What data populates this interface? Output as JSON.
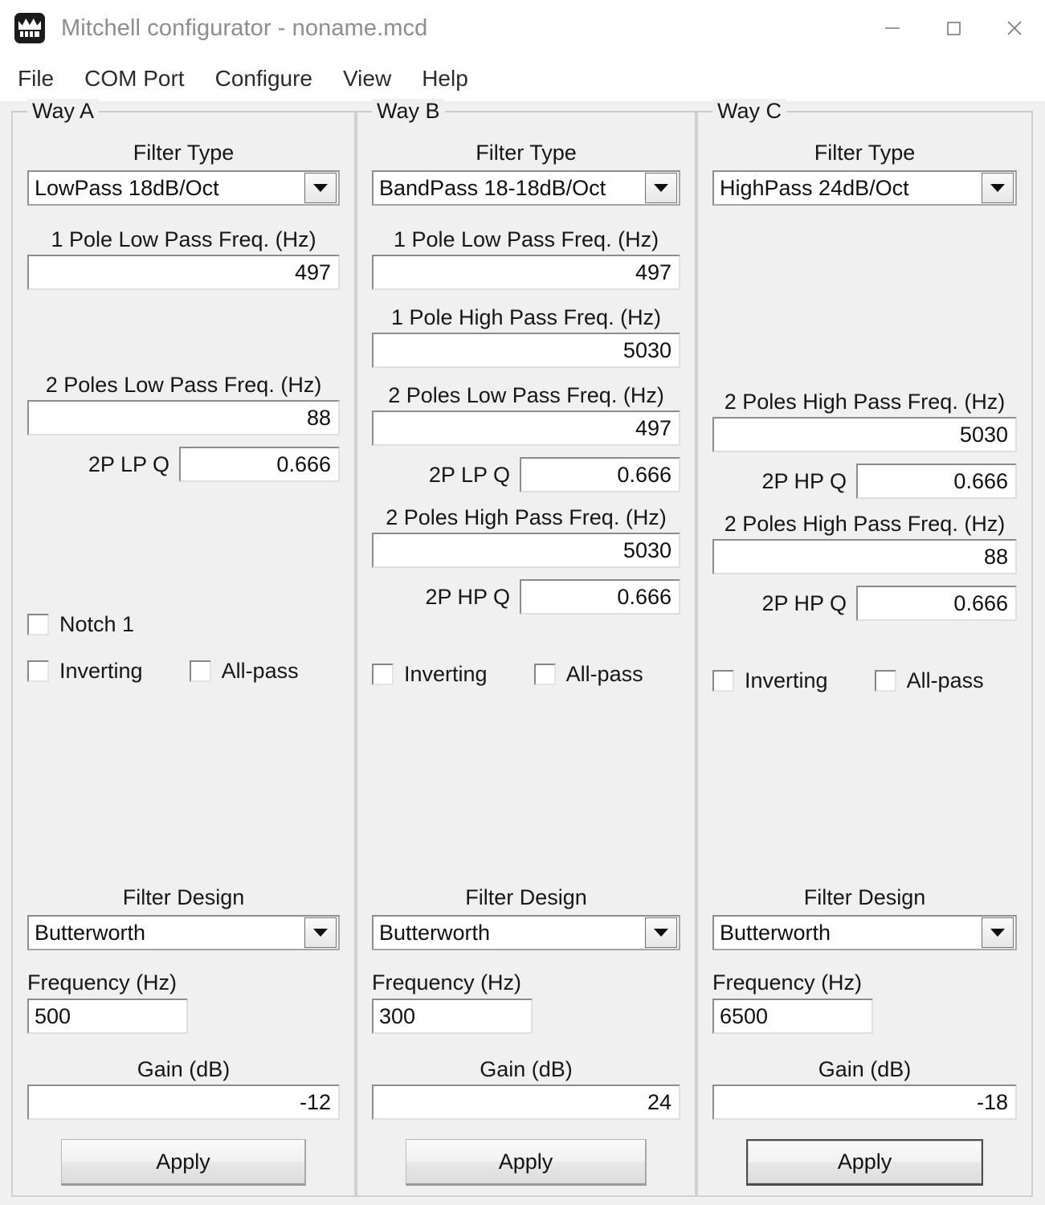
{
  "window": {
    "title": "Mitchell configurator - noname.mcd",
    "icon": "app-icon",
    "minimize": "minimize-icon",
    "maximize": "maximize-icon",
    "close": "close-icon"
  },
  "menu": {
    "items": [
      {
        "label": "File"
      },
      {
        "label": "COM Port"
      },
      {
        "label": "Configure"
      },
      {
        "label": "View"
      },
      {
        "label": "Help"
      }
    ]
  },
  "labels": {
    "filter_type": "Filter Type",
    "one_pole_low_pass": "1 Pole Low Pass Freq. (Hz)",
    "one_pole_high_pass": "1 Pole High Pass Freq. (Hz)",
    "two_poles_low_pass": "2 Poles Low Pass Freq. (Hz)",
    "two_poles_high_pass": "2 Poles High Pass Freq. (Hz)",
    "two_p_lp_q": "2P LP Q",
    "two_p_hp_q": "2P HP Q",
    "notch1": "Notch 1",
    "inverting": "Inverting",
    "allpass": "All-pass",
    "filter_design": "Filter Design",
    "frequency": "Frequency (Hz)",
    "gain": "Gain (dB)",
    "apply": "Apply"
  },
  "ways": {
    "a": {
      "legend": "Way A",
      "filter_type": "LowPass 18dB/Oct",
      "one_pole_low_pass": "497",
      "two_poles_low_pass": "88",
      "two_p_lp_q": "0.666",
      "notch1_checked": false,
      "inverting_checked": false,
      "allpass_checked": false,
      "filter_design": "Butterworth",
      "frequency": "500",
      "gain": "-12",
      "apply": "Apply"
    },
    "b": {
      "legend": "Way B",
      "filter_type": "BandPass 18-18dB/Oct",
      "one_pole_low_pass": "497",
      "one_pole_high_pass": "5030",
      "two_poles_low_pass": "497",
      "two_p_lp_q": "0.666",
      "two_poles_high_pass": "5030",
      "two_p_hp_q": "0.666",
      "inverting_checked": false,
      "allpass_checked": false,
      "filter_design": "Butterworth",
      "frequency": "300",
      "gain": "24",
      "apply": "Apply"
    },
    "c": {
      "legend": "Way C",
      "filter_type": "HighPass 24dB/Oct",
      "two_poles_high_pass_1": "5030",
      "two_p_hp_q_1": "0.666",
      "two_poles_high_pass_2": "88",
      "two_p_hp_q_2": "0.666",
      "inverting_checked": false,
      "allpass_checked": false,
      "filter_design": "Butterworth",
      "frequency": "6500",
      "gain": "-18",
      "apply": "Apply"
    }
  },
  "colors": {
    "window_bg": "#f0f0f0",
    "titlebar_bg": "#ffffff",
    "title_text": "#8d8d8d",
    "text": "#161616",
    "field_bg": "#ffffff",
    "group_border": "#d0d0d0"
  }
}
